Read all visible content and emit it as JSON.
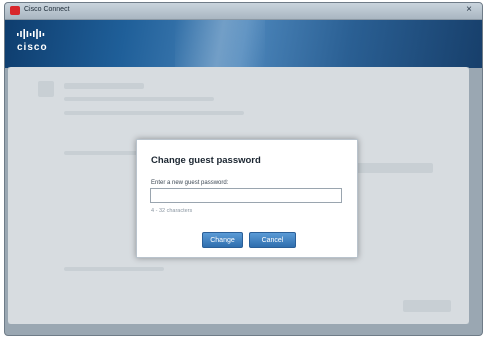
{
  "window": {
    "title": "Cisco Connect",
    "close_symbol": "×"
  },
  "header": {
    "brand": "cisco"
  },
  "dialog": {
    "title": "Change guest password",
    "label": "Enter a new guest password:",
    "input_value": "",
    "hint": "4 - 32 characters",
    "change_label": "Change",
    "cancel_label": "Cancel"
  },
  "icons": {
    "app": "cisco-app-icon",
    "close": "close-icon",
    "logo": "cisco-logo-icon"
  },
  "colors": {
    "header": "#1f5f99",
    "button": "#2f6eae",
    "brand_red": "#d8262b"
  }
}
